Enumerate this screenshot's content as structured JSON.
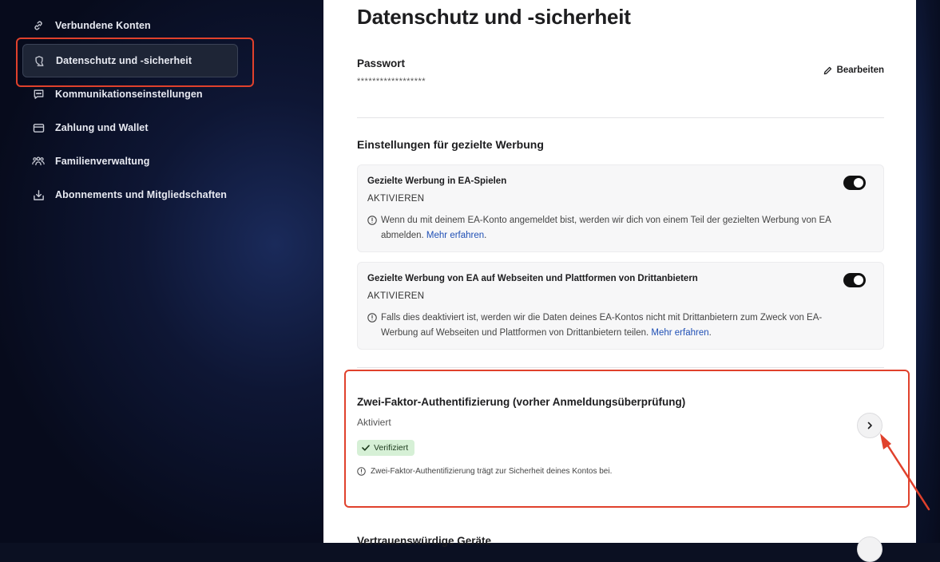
{
  "sidebar": {
    "items": [
      {
        "label": "Verbundene Konten",
        "icon": "link-icon"
      },
      {
        "label": "Datenschutz und -sicherheit",
        "icon": "shield-hand-icon",
        "active": true
      },
      {
        "label": "Kommunikationseinstellungen",
        "icon": "chat-icon"
      },
      {
        "label": "Zahlung und Wallet",
        "icon": "card-icon"
      },
      {
        "label": "Familienverwaltung",
        "icon": "family-icon"
      },
      {
        "label": "Abonnements und Mitgliedschaften",
        "icon": "download-box-icon"
      }
    ]
  },
  "main": {
    "title": "Datenschutz und -sicherheit",
    "password": {
      "label": "Passwort",
      "mask": "******************",
      "edit_label": "Bearbeiten"
    },
    "ads": {
      "heading": "Einstellungen für gezielte Werbung",
      "cards": [
        {
          "title": "Gezielte Werbung in EA-Spielen",
          "status": "AKTIVIEREN",
          "info": "Wenn du mit deinem EA-Konto angemeldet bist, werden wir dich von einem Teil der gezielten Werbung von EA abmelden.",
          "link": "Mehr erfahren",
          "link_suffix": "."
        },
        {
          "title": "Gezielte Werbung von EA auf Webseiten und Plattformen von Drittanbietern",
          "status": "AKTIVIEREN",
          "info": "Falls dies deaktiviert ist, werden wir die Daten deines EA-Kontos nicht mit Drittanbietern zum Zweck von EA-Werbung auf Webseiten und Plattformen von Drittanbietern teilen.",
          "link": "Mehr erfahren",
          "link_suffix": "."
        }
      ]
    },
    "two_factor": {
      "title": "Zwei-Faktor-Authentifizierung (vorher Anmeldungsüberprüfung)",
      "status": "Aktiviert",
      "badge": "Verifiziert",
      "info": "Zwei-Faktor-Authentifizierung trägt zur Sicherheit deines Kontos bei."
    },
    "next_section": {
      "title": "Vertrauenswürdige Geräte"
    }
  },
  "colors": {
    "highlight": "#e0412c",
    "link": "#1f4fb5",
    "badge_bg": "#d6f0d6"
  }
}
